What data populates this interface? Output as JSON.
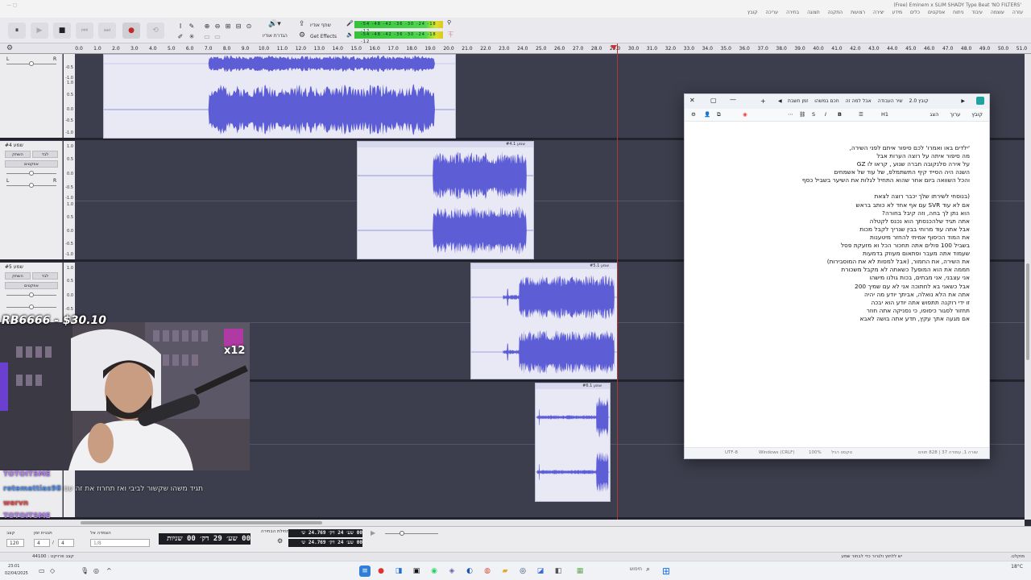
{
  "window": {
    "title": "(Free) Eminem x SLIM SHADY Type Beat 'NO FILTERS'",
    "menu": [
      "עזרה",
      "עוצמה",
      "עיבוד",
      "ניתוח",
      "אפקטים",
      "כלים",
      "מידע",
      "יצירה",
      "רצועות",
      "התקנה",
      "תצוגה",
      "בחירה",
      "עריכה",
      "קובץ"
    ]
  },
  "toolbar": {
    "pause": "⏸",
    "play": "▶",
    "stop": "■",
    "skip_start": "⏮",
    "skip_end": "⏭",
    "record": "●",
    "audio_setup_label": "הגדרת אודיו",
    "share_label": "שתף אודיו",
    "effects_label": "Get Effects",
    "meter_scale": "-54 -48 -42 -36 -30 -24 -18 -12"
  },
  "ruler": {
    "ticks": [
      "0.0",
      "1.0",
      "2.0",
      "3.0",
      "4.0",
      "5.0",
      "6.0",
      "7.0",
      "8.0",
      "9.0",
      "10.0",
      "11.0",
      "12.0",
      "13.0",
      "14.0",
      "15.0",
      "16.0",
      "17.0",
      "18.0",
      "19.0",
      "20.0",
      "21.0",
      "22.0",
      "23.0",
      "24.0",
      "25.0",
      "26.0",
      "27.0",
      "28.0",
      "29.0",
      "30.0",
      "31.0",
      "32.0",
      "33.0",
      "34.0",
      "35.0",
      "36.0",
      "37.0",
      "38.0",
      "39.0",
      "40.0",
      "41.0",
      "42.0",
      "43.0",
      "44.0",
      "45.0",
      "46.0",
      "47.0",
      "48.0",
      "49.0",
      "50.0",
      "51.0"
    ]
  },
  "tracks": {
    "scale_labels": [
      "1.0",
      "0.5",
      "0.0",
      "-0.5",
      "-1.0"
    ],
    "mute": "השתק",
    "solo": "לבד",
    "effects": "אפקטים",
    "left": "L",
    "right": "R",
    "t2_name": "שמע #4",
    "t3_name": "שמע #5",
    "clip2": "שמע #4.1",
    "clip3": "שמע #5.1",
    "clip4": "שמע #6.1"
  },
  "overlay": {
    "donation": "RB6666 - $30.10",
    "badge": "x12",
    "chat": [
      {
        "user": "TOTOITSME",
        "text": "",
        "color": "#b07ef0"
      },
      {
        "user": "rotemattias98",
        "text": "תגיד משהו שקשור לביבי ואז תחרוז את זה עם",
        "color": "#4f8ff0"
      },
      {
        "user": "wervn",
        "text": "",
        "color": "#e94a4a"
      },
      {
        "user": "TOTOITSME",
        "text": "",
        "color": "#b07ef0"
      }
    ]
  },
  "notepad": {
    "tabs": [
      "קובץ 2.0",
      "שיר העבודה",
      "אבל למה זה",
      "חכם במשהו",
      "זמן חשבת"
    ],
    "menu": [
      "קובץ",
      "ערוך",
      "הצג"
    ],
    "heading_btn": "H1",
    "paragraph1": [
      "'ילדים באו ואמרו' לכם סיפור איתם לפני השירה,",
      "מה סיפור איתה על רוצה הערות אבל",
      "על אירה סלנקובה חברה שנוע , קראו לו GZ",
      "השנה היה הסייד קיף התשתמלפ, של עוד של אשמחים",
      "והכל השוואה ביום אחר שהוא התחיל לגלות את השיער בשביל כסף"
    ],
    "paragraph2": [
      "(בנוסחי לשירתו שלך יכבר רוצה לצאת",
      "אם לא עוד SVR עם אף אחד לא כותב בראש",
      "הוא נתן לך בחה, וזה קיבל בחורה?",
      "אתה תגיד שלהכנסתך הוא נכנס לקטלה",
      "אבל אתה עוד מרוחי בבין שנריך לקבל מכות",
      "את המוד הכיסוף אמיתי להחזר מיטענות",
      "בשביל 100 פולים אתה תחכור הכל וא מזעקת פסל",
      "שעמוד אתה מעבר ופתאום מעוזק בדמעות",
      "את השירה, את החמור, (אבל למסות לא את המוסבירות)",
      "חממה את הוא המופע? כשאתה לא מקבל משכורת",
      "אני עצבני, אני מבתים, בכות גולנו מישהו",
      "אבל כשאני בא לחתוכה אני לא עם שמיך 200",
      "אתה את הלא נואלה, אביתך יודע מה יהיה",
      "זו ידי רוקנה תתפוש אתה יודע הוא יבכה",
      "תחזור לסגור כיסופו, כי נסניקה אתה חוזר",
      "אם מגעה אתך עקץ, תדע אתה בושה לאבא"
    ],
    "status": [
      "שורה 1, עמודה 37 | 828 תווים",
      "טקסט רגיל",
      "100%",
      "Windows (CRLF)",
      "UTF-8"
    ]
  },
  "bottom": {
    "tempo_label": "קצב",
    "tempo": "120",
    "timesig_label": "תבנית זמן",
    "ts_num": "4",
    "ts_den": "4",
    "snap_label": "הצמדה אל",
    "snap_value": "1/8",
    "time_display": "00 שע׳ 29 דק׳ 00 שניות",
    "selection_label": "תחילת הבחירה",
    "sel_start": "00 שע׳ 24 דק׳ 24.769 ש׳",
    "sel_end": "00 שע׳ 24 דק׳ 24.769 ש׳"
  },
  "status": {
    "left": "44100 : קצב פרויקט",
    "right": "יש ללחוץ ולגרור כדי לבחור שמע",
    "far_right": "מוקלט."
  },
  "taskbar": {
    "clock": "23:01",
    "date": "02/04/2025",
    "weather": "18°C",
    "search": "חיפוש"
  },
  "colors": {
    "waveform": "#5d5ed6",
    "clip_bg": "#e9e9f6",
    "track_bg": "#3d3e4d",
    "playhead": "#b33636"
  }
}
